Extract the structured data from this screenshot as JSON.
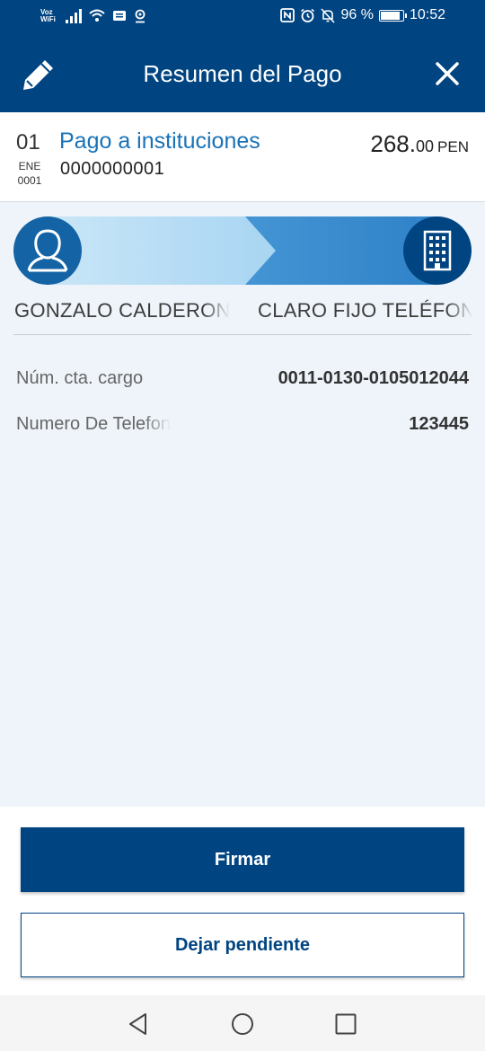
{
  "status_bar": {
    "voz_wifi_line1": "Voz",
    "voz_wifi_line2": "WiFi",
    "battery_text": "96 %",
    "battery_level": 0.96,
    "time": "10:52",
    "icons": [
      "signal-icon",
      "wifi-icon",
      "message-icon",
      "location-icon",
      "nfc-icon",
      "alarm-icon",
      "mute-icon",
      "battery-icon"
    ]
  },
  "header": {
    "title": "Resumen del Pago",
    "left_icon": "pencil-icon",
    "right_icon": "close-icon"
  },
  "summary": {
    "day": "01",
    "month": "ENE",
    "year": "0001",
    "title": "Pago a instituciones",
    "reference": "0000000001",
    "amount_int": "268.",
    "amount_dec": "00",
    "currency": "PEN"
  },
  "flow": {
    "from_name": "GONZALO CALDERON",
    "to_name": "CLARO FIJO TELÉFONO",
    "from_icon": "user-icon",
    "to_icon": "building-icon"
  },
  "details": [
    {
      "label": "Núm. cta. cargo",
      "value": "0011-0130-0105012044"
    },
    {
      "label": "Numero De Telefono",
      "value": "123445"
    }
  ],
  "actions": {
    "primary": "Firmar",
    "secondary": "Dejar pendiente"
  },
  "colors": {
    "brand_dark": "#004481",
    "brand_mid": "#1464a5",
    "link_blue": "#1973b8",
    "background": "#eef4fa"
  }
}
